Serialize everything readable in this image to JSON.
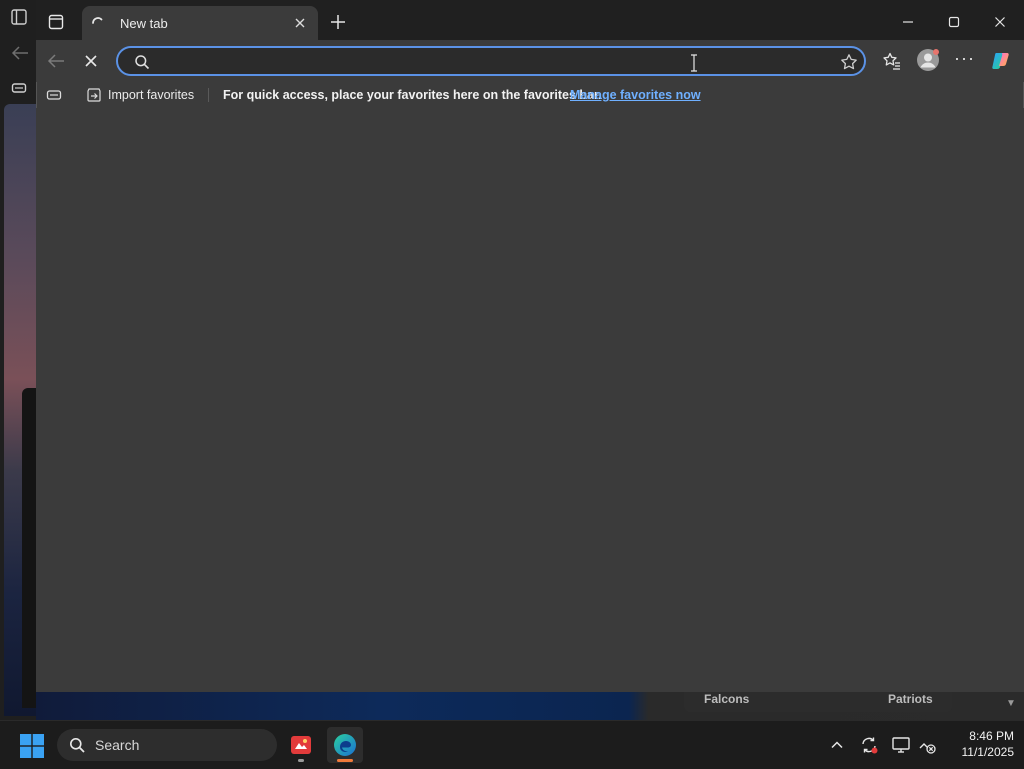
{
  "browser": {
    "tab": {
      "title": "New tab",
      "state": "loading"
    },
    "address_bar": {
      "value": "",
      "placeholder": ""
    },
    "favorites_bar": {
      "import_label": "Import favorites",
      "hint": "For quick access, place your favorites here on the favorites bar.",
      "manage_link": "Manage favorites now"
    },
    "accent_color": "#5b92e6",
    "link_color": "#6fb0ff"
  },
  "background": {
    "sports": {
      "team_left": "Falcons",
      "team_right": "Patriots"
    }
  },
  "taskbar": {
    "search_label": "Search",
    "pinned_apps": [
      "games-app",
      "microsoft-edge"
    ],
    "clock": {
      "time": "8:46 PM",
      "date": "11/1/2025"
    }
  }
}
